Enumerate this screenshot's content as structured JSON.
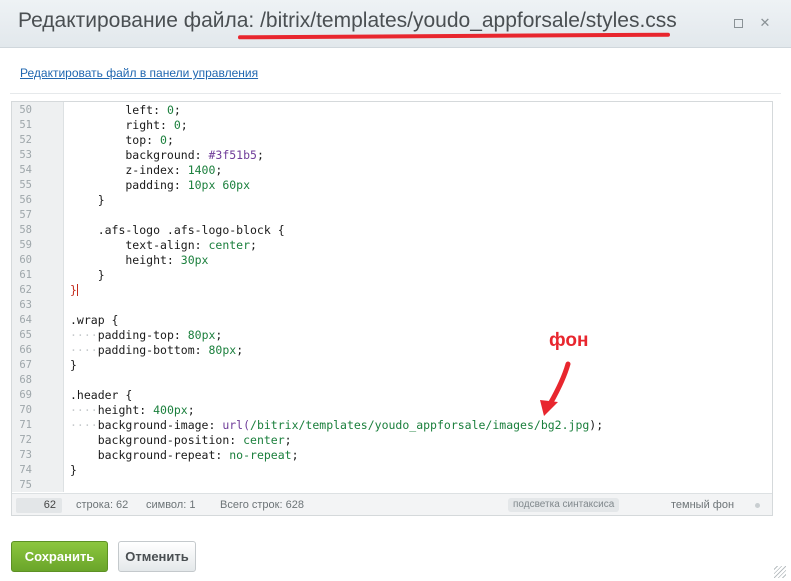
{
  "window": {
    "title": "Редактирование файла: /bitrix/templates/youdo_appforsale/styles.css",
    "maximize_icon": "maximize-icon",
    "close_icon": "close-icon",
    "close_glyph": "✕"
  },
  "edit_link": "Редактировать файл в панели управления",
  "editor": {
    "lines": [
      {
        "n": "50",
        "segs": [
          {
            "t": "        left: ",
            "c": ""
          },
          {
            "t": "0",
            "c": "c-val"
          },
          {
            "t": ";",
            "c": ""
          }
        ]
      },
      {
        "n": "51",
        "segs": [
          {
            "t": "        right: ",
            "c": ""
          },
          {
            "t": "0",
            "c": "c-val"
          },
          {
            "t": ";",
            "c": ""
          }
        ]
      },
      {
        "n": "52",
        "segs": [
          {
            "t": "        top: ",
            "c": ""
          },
          {
            "t": "0",
            "c": "c-val"
          },
          {
            "t": ";",
            "c": ""
          }
        ]
      },
      {
        "n": "53",
        "segs": [
          {
            "t": "        background: ",
            "c": ""
          },
          {
            "t": "#3f51b5",
            "c": "c-str"
          },
          {
            "t": ";",
            "c": ""
          }
        ]
      },
      {
        "n": "54",
        "segs": [
          {
            "t": "        z-index: ",
            "c": ""
          },
          {
            "t": "1400",
            "c": "c-val"
          },
          {
            "t": ";",
            "c": ""
          }
        ]
      },
      {
        "n": "55",
        "segs": [
          {
            "t": "        padding: ",
            "c": ""
          },
          {
            "t": "10px 60px",
            "c": "c-val"
          }
        ]
      },
      {
        "n": "56",
        "segs": [
          {
            "t": "    }",
            "c": ""
          }
        ]
      },
      {
        "n": "57",
        "segs": []
      },
      {
        "n": "58",
        "segs": [
          {
            "t": "    .afs-logo .afs-logo-block {",
            "c": ""
          }
        ]
      },
      {
        "n": "59",
        "segs": [
          {
            "t": "        text-align: ",
            "c": ""
          },
          {
            "t": "center",
            "c": "c-val"
          },
          {
            "t": ";",
            "c": ""
          }
        ]
      },
      {
        "n": "60",
        "segs": [
          {
            "t": "        height: ",
            "c": ""
          },
          {
            "t": "30px",
            "c": "c-val"
          }
        ]
      },
      {
        "n": "61",
        "segs": [
          {
            "t": "    }",
            "c": ""
          }
        ]
      },
      {
        "n": "62",
        "segs": [
          {
            "t": "}",
            "c": "c-red"
          }
        ],
        "cursor": true
      },
      {
        "n": "63",
        "segs": []
      },
      {
        "n": "64",
        "segs": [
          {
            "t": ".wrap {",
            "c": ""
          }
        ]
      },
      {
        "n": "65",
        "segs": [
          {
            "t": "····",
            "c": "tab-dots"
          },
          {
            "t": "padding-top: ",
            "c": ""
          },
          {
            "t": "80px",
            "c": "c-val"
          },
          {
            "t": ";",
            "c": ""
          }
        ]
      },
      {
        "n": "66",
        "segs": [
          {
            "t": "····",
            "c": "tab-dots"
          },
          {
            "t": "padding-bottom: ",
            "c": ""
          },
          {
            "t": "80px",
            "c": "c-val"
          },
          {
            "t": ";",
            "c": ""
          }
        ]
      },
      {
        "n": "67",
        "segs": [
          {
            "t": "}",
            "c": ""
          }
        ]
      },
      {
        "n": "68",
        "segs": []
      },
      {
        "n": "69",
        "segs": [
          {
            "t": ".header {",
            "c": ""
          }
        ]
      },
      {
        "n": "70",
        "segs": [
          {
            "t": "····",
            "c": "tab-dots"
          },
          {
            "t": "height: ",
            "c": ""
          },
          {
            "t": "400px",
            "c": "c-val"
          },
          {
            "t": ";",
            "c": ""
          }
        ]
      },
      {
        "n": "71",
        "segs": [
          {
            "t": "····",
            "c": "tab-dots"
          },
          {
            "t": "background-image: ",
            "c": ""
          },
          {
            "t": "url(",
            "c": "c-str"
          },
          {
            "t": "/bitrix/templates/youdo_appforsale/images/bg2.jpg",
            "c": "c-val"
          },
          {
            "t": ");",
            "c": ""
          }
        ]
      },
      {
        "n": "72",
        "segs": [
          {
            "t": "    background-position: ",
            "c": ""
          },
          {
            "t": "center",
            "c": "c-val"
          },
          {
            "t": ";",
            "c": ""
          }
        ]
      },
      {
        "n": "73",
        "segs": [
          {
            "t": "    background-repeat: ",
            "c": ""
          },
          {
            "t": "no-repeat",
            "c": "c-val"
          },
          {
            "t": ";",
            "c": ""
          }
        ]
      },
      {
        "n": "74",
        "segs": [
          {
            "t": "}",
            "c": ""
          }
        ]
      },
      {
        "n": "75",
        "segs": []
      }
    ]
  },
  "status": {
    "goto_line": "62",
    "line": "строка: 62",
    "symbol": "символ: 1",
    "total": "Всего строк: 628",
    "syntax_toggle": "подсветка синтаксиса",
    "dark_bg": "темный фон"
  },
  "annotation": {
    "text": "фон",
    "color": "#e8262e"
  },
  "buttons": {
    "save": "Сохранить",
    "cancel": "Отменить"
  },
  "colors": {
    "accent_green": "#7ab833",
    "link_blue": "#2067b0",
    "annotation_red": "#e8262e"
  }
}
